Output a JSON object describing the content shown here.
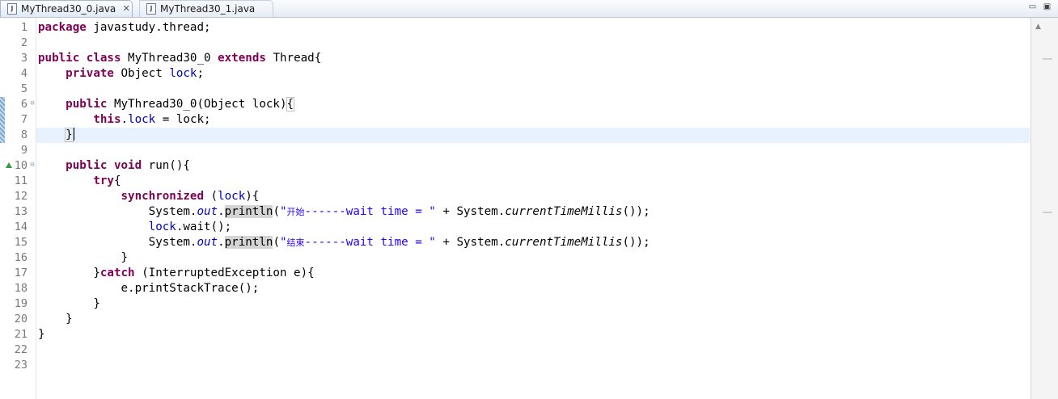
{
  "tabs": [
    {
      "label": "MyThread30_0.java",
      "active": true,
      "close_glyph": "✕"
    },
    {
      "label": "MyThread30_1.java",
      "active": false
    }
  ],
  "window_controls": {
    "minimize": "▭",
    "maximize": "▣"
  },
  "editor": {
    "current_line": 8,
    "lines": [
      {
        "num": "1",
        "s1": "package",
        "t1": " javastudy.thread;"
      },
      {
        "num": "2"
      },
      {
        "num": "3",
        "s1": "public",
        "t1": " ",
        "s2": "class",
        "t2": " MyThread30_0 ",
        "s3": "extends",
        "t3": " Thread{"
      },
      {
        "num": "4",
        "t0": "    ",
        "s1": "private",
        "t1": " Object ",
        "f1": "lock",
        "t2": ";"
      },
      {
        "num": "5"
      },
      {
        "num": "6",
        "t0": "    ",
        "s1": "public",
        "t1": " MyThread30_0(Object lock)",
        "t2": "{"
      },
      {
        "num": "7",
        "t0": "        ",
        "s1": "this",
        "t1": ".",
        "f1": "lock",
        "t2": " = lock;"
      },
      {
        "num": "8",
        "t0": "    ",
        "t1": "}"
      },
      {
        "num": "9"
      },
      {
        "num": "10",
        "t0": "    ",
        "s1": "public",
        "t1": " ",
        "s2": "void",
        "t2": " run(){"
      },
      {
        "num": "11",
        "t0": "        ",
        "s1": "try",
        "t1": "{"
      },
      {
        "num": "12",
        "t0": "            ",
        "s1": "synchronized",
        "t1": " (",
        "f1": "lock",
        "t2": "){"
      },
      {
        "num": "13",
        "t0": "                System.",
        "sf": "out",
        "t1": ".",
        "m": "println",
        "t2": "(",
        "q1": "\"",
        "cn": "开始",
        "q2": "------wait time = \"",
        "t3": " + System.",
        "sm": "currentTimeMillis",
        "t4": "());"
      },
      {
        "num": "14",
        "t0": "                ",
        "f1": "lock",
        "t1": ".wait();"
      },
      {
        "num": "15",
        "t0": "                System.",
        "sf": "out",
        "t1": ".",
        "m": "println",
        "t2": "(",
        "q1": "\"",
        "cn": "结束",
        "q2": "------wait time = \"",
        "t3": " + System.",
        "sm": "currentTimeMillis",
        "t4": "());"
      },
      {
        "num": "16",
        "t0": "            }"
      },
      {
        "num": "17",
        "t0": "        }",
        "s1": "catch",
        "t1": " (InterruptedException e){"
      },
      {
        "num": "18",
        "t0": "            e.printStackTrace();"
      },
      {
        "num": "19",
        "t0": "        }"
      },
      {
        "num": "20",
        "t0": "    }"
      },
      {
        "num": "21",
        "t0": "}"
      },
      {
        "num": "22"
      },
      {
        "num": "23"
      }
    ]
  },
  "colors": {
    "keyword": "#7f0055",
    "field": "#0000c0",
    "string": "#2a00ff",
    "current_line": "#e8f2fe",
    "line_number": "#787878",
    "override_marker": "#2e9b45"
  },
  "icons": {
    "file_tab": "java-file-icon",
    "close": "close-icon",
    "fold": "fold-collapse-icon",
    "override": "override-triangle-icon"
  }
}
